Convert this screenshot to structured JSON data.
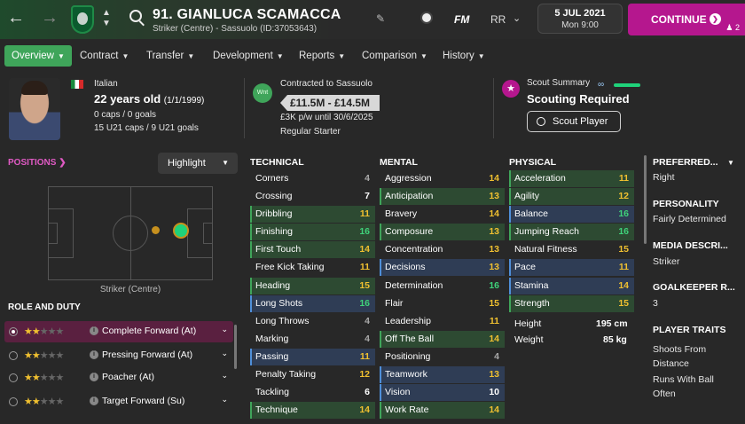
{
  "topbar": {
    "player_name": "91. GIANLUCA SCAMACCA",
    "player_sub": "Striker (Centre) - Sassuolo (ID:37053643)",
    "fm_label": "FM",
    "rr_label": "RR",
    "date": "5 JUL 2021",
    "time": "Mon 9:00",
    "continue_label": "CONTINUE",
    "inbox_count": "2"
  },
  "tabs": [
    {
      "label": "Overview"
    },
    {
      "label": "Contract"
    },
    {
      "label": "Transfer"
    },
    {
      "label": "Development"
    },
    {
      "label": "Reports"
    },
    {
      "label": "Comparison"
    },
    {
      "label": "History"
    }
  ],
  "info": {
    "nationality": "Italian",
    "age_main": "22 years old",
    "age_dob": "(1/1/1999)",
    "caps": "0 caps / 0 goals",
    "u21": "15 U21 caps / 9 U21 goals",
    "wnt": "Wnt",
    "contracted": "Contracted to Sassuolo",
    "value": "£11.5M - £14.5M",
    "wage": "£3K p/w until 30/6/2025",
    "status": "Regular Starter",
    "scout_title": "Scout Summary",
    "scout_status": "Scouting Required",
    "scout_button": "Scout Player"
  },
  "positions": {
    "title": "POSITIONS",
    "highlight": "Highlight",
    "caption": "Striker (Centre)"
  },
  "roles": {
    "title": "ROLE AND DUTY",
    "items": [
      {
        "label": "Complete Forward (At)",
        "stars": 2
      },
      {
        "label": "Pressing Forward (At)",
        "stars": 2
      },
      {
        "label": "Poacher (At)",
        "stars": 2
      },
      {
        "label": "Target Forward (Su)",
        "stars": 2
      }
    ]
  },
  "technical": {
    "title": "TECHNICAL",
    "items": [
      {
        "name": "Corners",
        "value": "4"
      },
      {
        "name": "Crossing",
        "value": "7"
      },
      {
        "name": "Dribbling",
        "value": "11"
      },
      {
        "name": "Finishing",
        "value": "16"
      },
      {
        "name": "First Touch",
        "value": "14"
      },
      {
        "name": "Free Kick Taking",
        "value": "11"
      },
      {
        "name": "Heading",
        "value": "15"
      },
      {
        "name": "Long Shots",
        "value": "16"
      },
      {
        "name": "Long Throws",
        "value": "4"
      },
      {
        "name": "Marking",
        "value": "4"
      },
      {
        "name": "Passing",
        "value": "11"
      },
      {
        "name": "Penalty Taking",
        "value": "12"
      },
      {
        "name": "Tackling",
        "value": "6"
      },
      {
        "name": "Technique",
        "value": "14"
      }
    ]
  },
  "mental": {
    "title": "MENTAL",
    "items": [
      {
        "name": "Aggression",
        "value": "14"
      },
      {
        "name": "Anticipation",
        "value": "13"
      },
      {
        "name": "Bravery",
        "value": "14"
      },
      {
        "name": "Composure",
        "value": "13"
      },
      {
        "name": "Concentration",
        "value": "13"
      },
      {
        "name": "Decisions",
        "value": "13"
      },
      {
        "name": "Determination",
        "value": "16"
      },
      {
        "name": "Flair",
        "value": "15"
      },
      {
        "name": "Leadership",
        "value": "11"
      },
      {
        "name": "Off The Ball",
        "value": "14"
      },
      {
        "name": "Positioning",
        "value": "4"
      },
      {
        "name": "Teamwork",
        "value": "13"
      },
      {
        "name": "Vision",
        "value": "10"
      },
      {
        "name": "Work Rate",
        "value": "14"
      }
    ]
  },
  "physical": {
    "title": "PHYSICAL",
    "items": [
      {
        "name": "Acceleration",
        "value": "11"
      },
      {
        "name": "Agility",
        "value": "12"
      },
      {
        "name": "Balance",
        "value": "16"
      },
      {
        "name": "Jumping Reach",
        "value": "16"
      },
      {
        "name": "Natural Fitness",
        "value": "15"
      },
      {
        "name": "Pace",
        "value": "11"
      },
      {
        "name": "Stamina",
        "value": "14"
      },
      {
        "name": "Strength",
        "value": "15"
      }
    ],
    "height_label": "Height",
    "height_value": "195 cm",
    "weight_label": "Weight",
    "weight_value": "85 kg"
  },
  "right": {
    "preferred_title": "PREFERRED...",
    "preferred_value": "Right",
    "personality_title": "PERSONALITY",
    "personality_value": "Fairly Determined",
    "media_title": "MEDIA DESCRI...",
    "media_value": "Striker",
    "gk_title": "GOALKEEPER R...",
    "gk_value": "3",
    "traits_title": "PLAYER TRAITS",
    "trait1": "Shoots From Distance",
    "trait2": "Runs With Ball Often"
  },
  "colors": {
    "accent_green": "#3fa55a",
    "accent_magenta": "#b5178e",
    "highlight_green_row": "#2d4a32",
    "highlight_blue_row": "#2f3d55"
  }
}
